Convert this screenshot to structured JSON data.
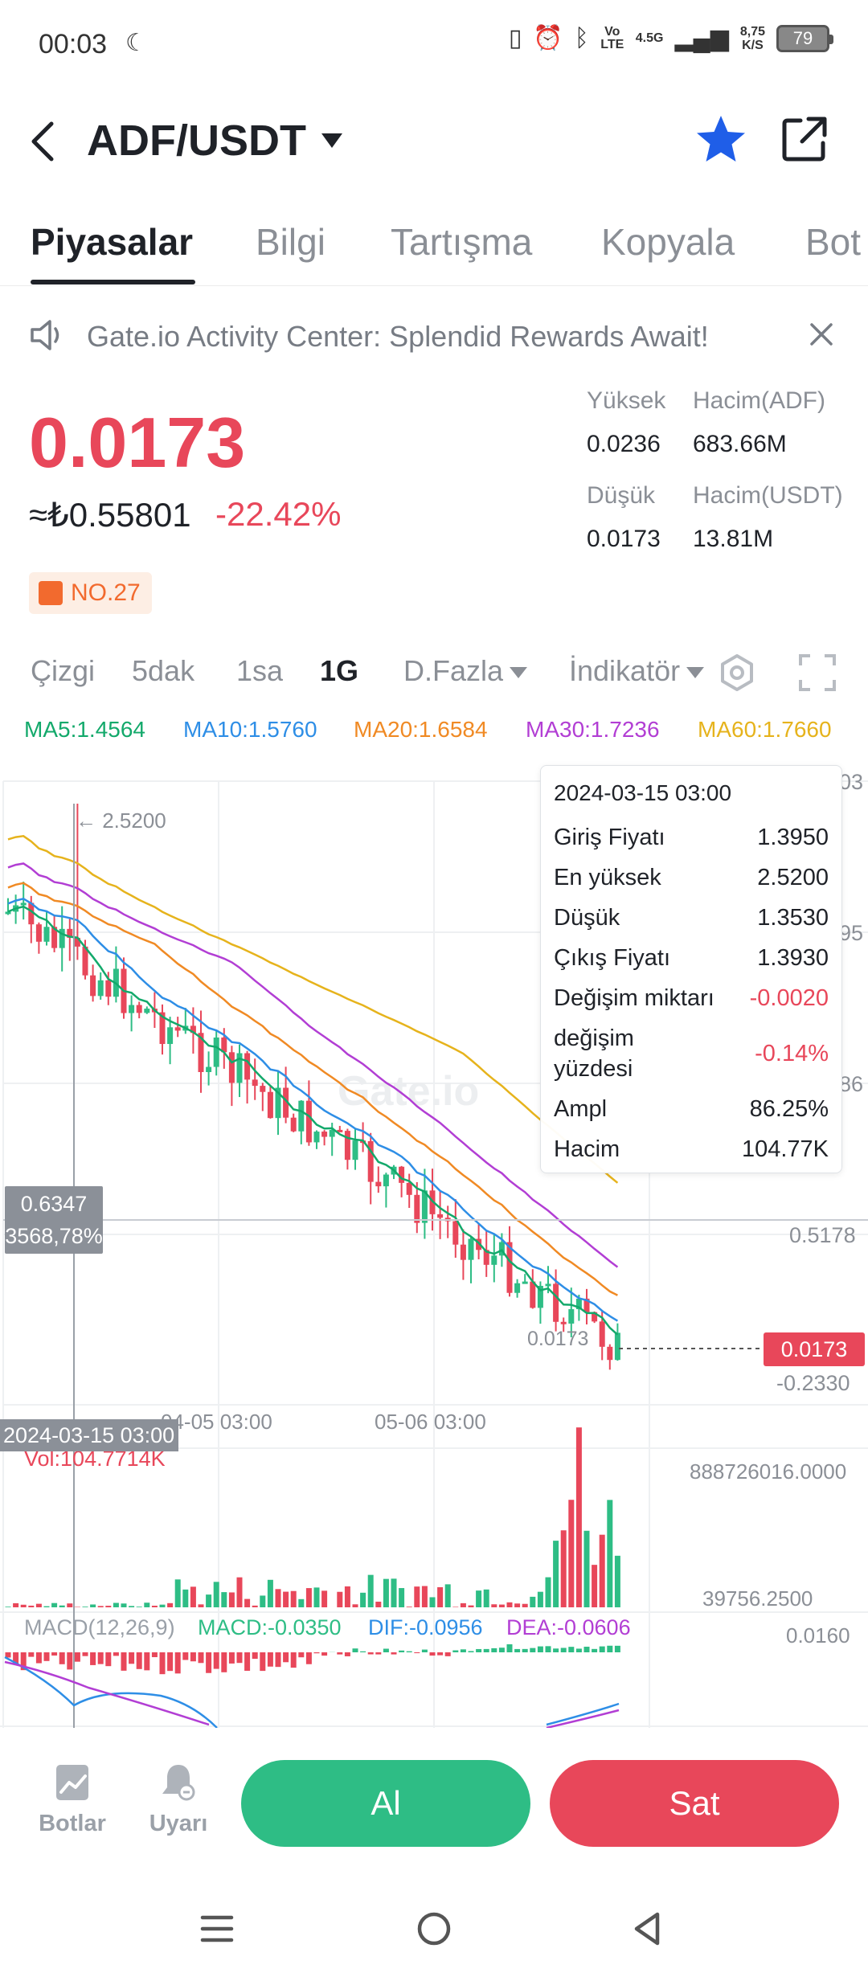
{
  "status_bar": {
    "time": "00:03",
    "net_label": "Vo LTE",
    "net_type": "4.5G",
    "speed_value": "8,75",
    "speed_unit": "K/S",
    "battery": "79"
  },
  "header": {
    "pair": "ADF/USDT"
  },
  "tabs": [
    "Piyasalar",
    "Bilgi",
    "Tartışma",
    "Kopyala",
    "Bot"
  ],
  "announcement": "Gate.io Activity Center: Splendid Rewards Await!",
  "price": {
    "last": "0.0173",
    "fiat": "≈₺0.55801",
    "change_pct": "-22.42%",
    "rank": "NO.27"
  },
  "stats": {
    "high_label": "Yüksek",
    "high_value": "0.0236",
    "low_label": "Düşük",
    "low_value": "0.0173",
    "vol_base_label": "Hacim(ADF)",
    "vol_base_value": "683.66M",
    "vol_quote_label": "Hacim(USDT)",
    "vol_quote_value": "13.81M"
  },
  "timeframes": {
    "line": "Çizgi",
    "m5": "5dak",
    "h1": "1sa",
    "d1": "1G",
    "more": "D.Fazla",
    "indicator": "İndikatör"
  },
  "ma_legend": [
    {
      "text": "MA5:1.4564",
      "color": "#13a96b"
    },
    {
      "text": "MA10:1.5760",
      "color": "#2e8ee6"
    },
    {
      "text": "MA20:1.6584",
      "color": "#f08a24"
    },
    {
      "text": "MA30:1.7236",
      "color": "#b23ed4"
    },
    {
      "text": "MA60:1.7660",
      "color": "#e6b31c"
    }
  ],
  "chart": {
    "peak_label": "← 2.5200",
    "right_axis_partial": [
      "03",
      "95",
      "86"
    ],
    "axis_mid": "0.5178",
    "axis_low": "-0.2330",
    "last_line_label": "0.0173",
    "last_price_tag": "0.0173",
    "x_labels": [
      "04-05 03:00",
      "05-06 03:00"
    ],
    "cursor_price": "0.6347",
    "cursor_pct": "3568,78%",
    "cursor_date": "2024-03-15 03:00",
    "watermark": "Gate.io",
    "vol_label": "Vol:104.7714K",
    "vol_max": "888726016.0000",
    "vol_min": "39756.2500",
    "macd_label": "MACD(12,26,9)",
    "macd_val": "MACD:-0.0350",
    "dif_val": "DIF:-0.0956",
    "dea_val": "DEA:-0.0606",
    "macd_axis": "0.0160"
  },
  "tooltip": {
    "date": "2024-03-15 03:00",
    "rows": [
      {
        "label": "Giriş Fiyatı",
        "value": "1.3950"
      },
      {
        "label": "En yüksek",
        "value": "2.5200"
      },
      {
        "label": "Düşük",
        "value": "1.3530"
      },
      {
        "label": "Çıkış Fiyatı",
        "value": "1.3930"
      },
      {
        "label": "Değişim miktarı",
        "value": "-0.0020"
      },
      {
        "label": "değişim yüzdesi",
        "value": "-0.14%"
      },
      {
        "label": "Ampl",
        "value": "86.25%"
      },
      {
        "label": "Hacim",
        "value": "104.77K"
      }
    ]
  },
  "bottom": {
    "bots_label": "Botlar",
    "alert_label": "Uyarı",
    "buy_label": "Al",
    "sell_label": "Sat"
  },
  "colors": {
    "up": "#2ebd85",
    "down": "#e8475a",
    "accent": "#1f5ee8"
  }
}
